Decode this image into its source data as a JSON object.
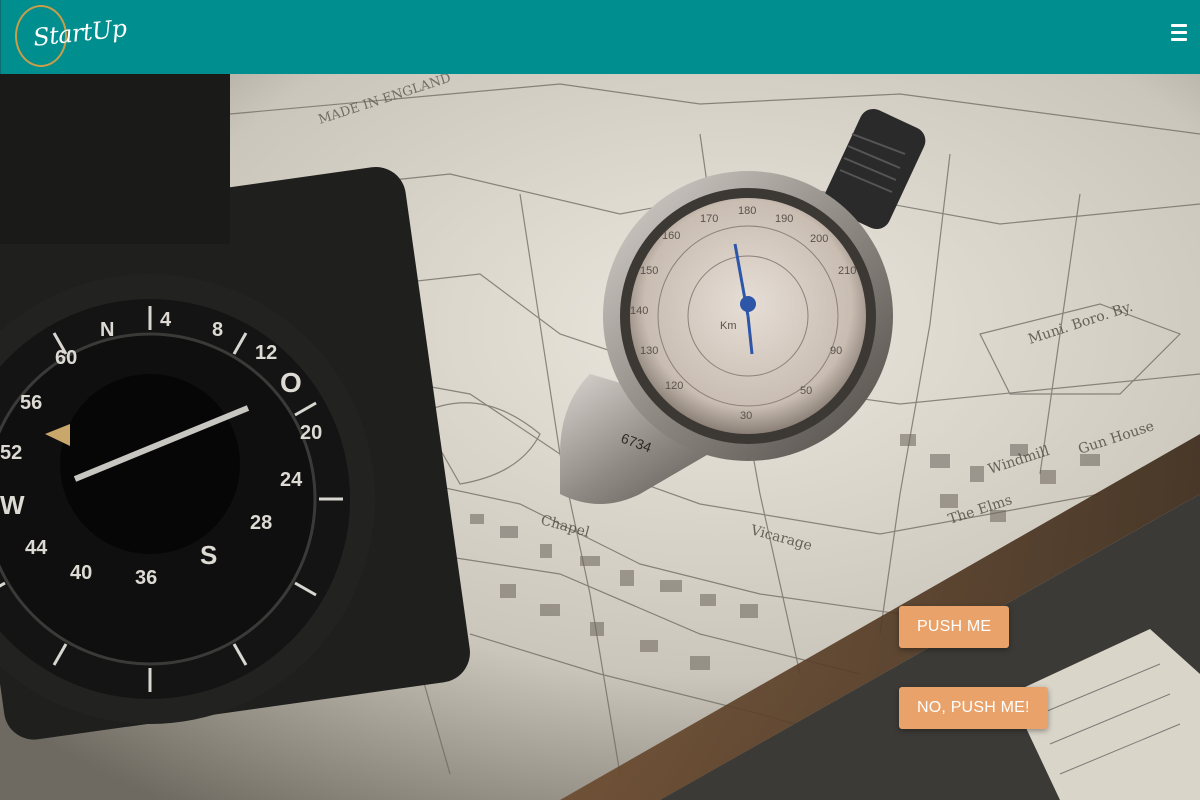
{
  "header": {
    "logo_text": "StartUp",
    "background_color": "#008e8f",
    "logo_ring_color": "#c99d4a",
    "menu_icon": "hamburger-menu-icon"
  },
  "hero": {
    "description_icon": "compass-and-map-photo"
  },
  "buttons": {
    "primary_label": "PUSH ME",
    "secondary_label": "NO, PUSH ME!",
    "color": "#e9a26a"
  }
}
